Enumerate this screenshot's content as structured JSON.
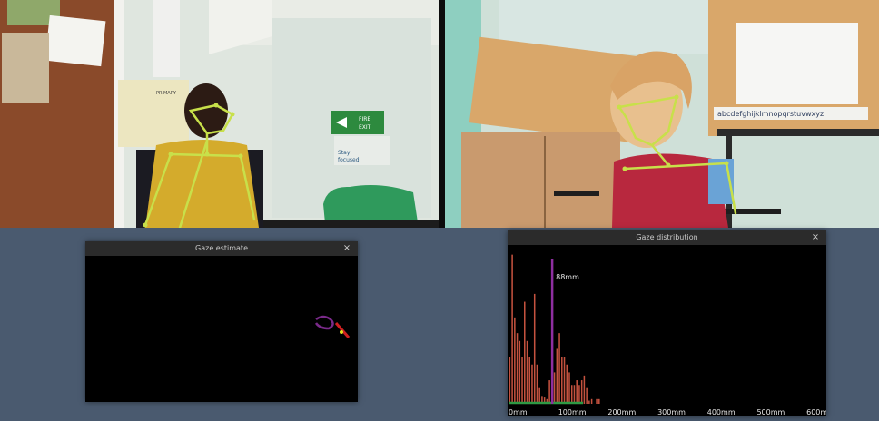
{
  "windows": {
    "estimate": {
      "title": "Gaze estimate",
      "close_label": "×"
    },
    "distribution": {
      "title": "Gaze distribution",
      "close_label": "×"
    }
  },
  "feeds": {
    "left": {
      "sign_fire_exit": [
        "FIRE",
        "EXIT"
      ],
      "sign_stay_focused": [
        "Stay",
        "focused"
      ],
      "poster_label": "PRIMARY"
    },
    "right": {
      "alphabet_strip": "abcdefghijklmnopqrstuvwxyz"
    }
  },
  "chart_data": {
    "type": "bar",
    "title": "",
    "xlabel": "",
    "ylabel": "",
    "x_unit": "mm",
    "xlim": [
      0,
      640
    ],
    "bin_width_mm": 5,
    "bin_start_mm": 0,
    "values": [
      30,
      95,
      55,
      45,
      40,
      30,
      65,
      40,
      30,
      25,
      70,
      25,
      10,
      5,
      4,
      3,
      15,
      25,
      20,
      35,
      45,
      30,
      30,
      25,
      20,
      12,
      12,
      15,
      12,
      15,
      18,
      10,
      2,
      3,
      0,
      3,
      3
    ],
    "ylim": [
      0,
      100
    ],
    "x_ticks": [
      {
        "value": 0,
        "label": "0mm"
      },
      {
        "value": 100,
        "label": "100mm"
      },
      {
        "value": 200,
        "label": "200mm"
      },
      {
        "value": 300,
        "label": "300mm"
      },
      {
        "value": 400,
        "label": "400mm"
      },
      {
        "value": 500,
        "label": "500mm"
      },
      {
        "value": 600,
        "label": "600mm"
      }
    ],
    "marker": {
      "value": 88,
      "label": "88mm",
      "color": "#8e2ea0"
    },
    "range_marker": {
      "from": 0,
      "to": 150,
      "color": "#2e9a44"
    },
    "bar_color": "#c4523f",
    "grid": false,
    "legend": "none"
  },
  "colors": {
    "skeleton": "#c8e04a",
    "desktop": "#4a5a6f",
    "titlebar": "#2b2b2b"
  }
}
